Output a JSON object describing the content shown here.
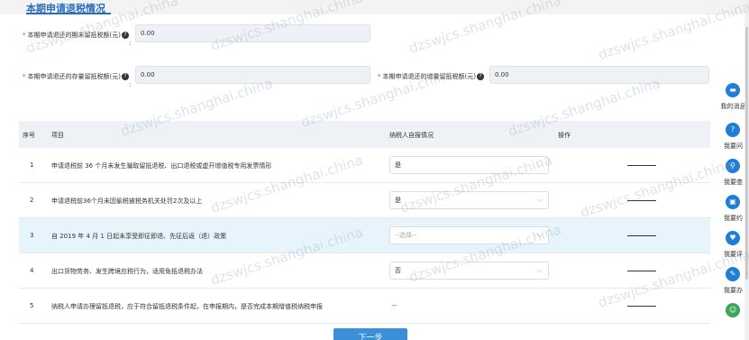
{
  "section": {
    "title": "本期申请退税情况"
  },
  "fields": {
    "f1": {
      "label": "本期申请退还的期末留抵税额(元)",
      "colon": ":",
      "value": "0.00"
    },
    "f2": {
      "label": "本期申请退还的存量留抵税额(元)",
      "colon": ":",
      "value": "0.00"
    },
    "f3": {
      "label": "本期申请退还的增量留抵税额(元)",
      "value": "0.00"
    },
    "required_mark": "*",
    "help_glyph": "?"
  },
  "table": {
    "headers": {
      "seq": "序号",
      "item": "项目",
      "status": "纳税人自报情况",
      "action": "操作"
    },
    "rows": [
      {
        "seq": "1",
        "item": "申请退税前 36 个月未发生骗取留抵退税、出口退税或虚开增值税专用发票情形",
        "status": "是"
      },
      {
        "seq": "2",
        "item": "申请退税前36个月未因偷税被税务机关处罚2次及以上",
        "status": "是"
      },
      {
        "seq": "3",
        "item": "自 2019 年 4 月 1 日起未享受即征即退、先征后返（退）政策",
        "status": "--选择--"
      },
      {
        "seq": "4",
        "item": "出口货物劳务、发生跨境应税行为，适用免抵退税办法",
        "status": "否"
      },
      {
        "seq": "5",
        "item": "纳税人申请办理留抵退税，应于符合留抵退税条件起，在申报期内，是否完成本期增值税纳税申报",
        "status": "--"
      }
    ]
  },
  "next_button": {
    "label": "下一步"
  },
  "sidebar": {
    "items": [
      {
        "label": "我的消息",
        "icon": "message-icon",
        "glyph": "▬"
      },
      {
        "label": "我要问",
        "icon": "question-icon",
        "glyph": "?"
      },
      {
        "label": "我要查",
        "icon": "search-icon",
        "glyph": "⚲"
      },
      {
        "label": "我要约",
        "icon": "calendar-icon",
        "glyph": "▣"
      },
      {
        "label": "我要评",
        "icon": "heart-icon",
        "glyph": "♥"
      },
      {
        "label": "我要办",
        "icon": "edit-icon",
        "glyph": "✎"
      }
    ]
  },
  "watermark": "dzswjcs.shanghai.china",
  "colors": {
    "accent": "#2a6ebb",
    "required": "#e63c3c",
    "button": "#3b8ed8",
    "sidebar_icon": "#1f7fd6"
  }
}
